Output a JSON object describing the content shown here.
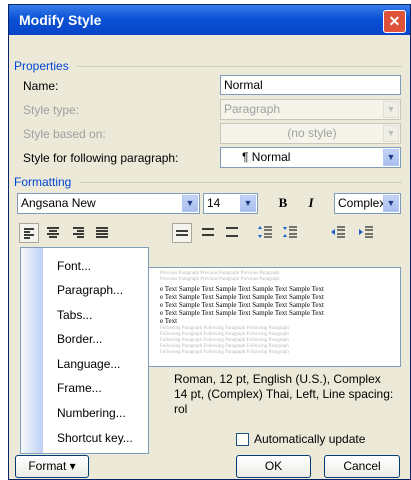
{
  "window": {
    "title": "Modify Style",
    "close_glyph": "✕"
  },
  "properties": {
    "group_label": "Properties",
    "name_label": "Name:",
    "name_value": "Normal",
    "style_type_label": "Style type:",
    "style_type_value": "Paragraph",
    "style_based_on_label": "Style based on:",
    "style_based_on_value": "(no style)",
    "following_label": "Style for following paragraph:",
    "following_value": "¶ Normal"
  },
  "formatting": {
    "group_label": "Formatting",
    "font": "Angsana New",
    "size": "14",
    "bold": "B",
    "italic": "I",
    "script": "Complex",
    "align_icons": [
      "align-left-icon",
      "align-center-icon",
      "align-right-icon",
      "justify-icon"
    ],
    "spacing_icons": [
      "single-space-icon",
      "one-half-space-icon",
      "double-space-icon"
    ],
    "para_space_icons": [
      "increase-paragraph-spacing-icon",
      "decrease-paragraph-spacing-icon"
    ],
    "indent_icons": [
      "decrease-indent-icon",
      "increase-indent-icon"
    ]
  },
  "preview": {
    "gray_lines": [
      "Previous Paragraph Previous Paragraph Previous Paragraph",
      "Previous Paragraph Previous Paragraph Previous Paragraph"
    ],
    "sample_lines": [
      "e Text Sample Text Sample Text Sample Text Sample Text",
      "e Text Sample Text Sample Text Sample Text Sample Text",
      "e Text Sample Text Sample Text Sample Text Sample Text",
      "e Text Sample Text Sample Text Sample Text Sample Text",
      "e Text"
    ],
    "following_lines": [
      "Following Paragraph Following Paragraph Following Paragraph",
      "Following Paragraph Following Paragraph Following Paragraph",
      "Following Paragraph Following Paragraph Following Paragraph",
      "Following Paragraph Following Paragraph Following Paragraph",
      "Following Paragraph Following Paragraph Following Paragraph"
    ]
  },
  "description": {
    "line1": "Roman, 12 pt, English (U.S.), Complex",
    "line2": "14 pt, (Complex) Thai, Left, Line spacing:",
    "line3": "rol"
  },
  "auto_update_label": "Automatically update",
  "buttons": {
    "format": "Format ▾",
    "ok": "OK",
    "cancel": "Cancel"
  },
  "format_menu": {
    "items": [
      "Font...",
      "Paragraph...",
      "Tabs...",
      "Border...",
      "Language...",
      "Frame...",
      "Numbering...",
      "Shortcut key..."
    ]
  },
  "colors": {
    "title_bar": "#0A52D6",
    "group_label": "#0046D5",
    "dialog_bg": "#ECE9D8"
  }
}
